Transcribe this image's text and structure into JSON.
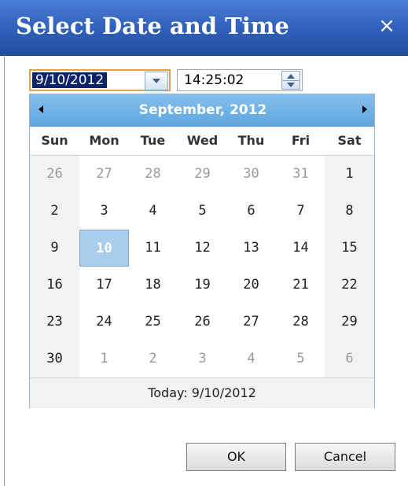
{
  "dialog": {
    "title": "Select Date and Time",
    "close_symbol": "×"
  },
  "date_input": {
    "value": "9/10/2012"
  },
  "time_input": {
    "value": "14:25:02"
  },
  "calendar": {
    "month_label": "September, 2012",
    "weekdays": [
      "Sun",
      "Mon",
      "Tue",
      "Wed",
      "Thu",
      "Fri",
      "Sat"
    ],
    "weeks": [
      [
        {
          "d": "26",
          "other": true
        },
        {
          "d": "27",
          "other": true
        },
        {
          "d": "28",
          "other": true
        },
        {
          "d": "29",
          "other": true
        },
        {
          "d": "30",
          "other": true
        },
        {
          "d": "31",
          "other": true
        },
        {
          "d": "1"
        }
      ],
      [
        {
          "d": "2"
        },
        {
          "d": "3"
        },
        {
          "d": "4"
        },
        {
          "d": "5"
        },
        {
          "d": "6"
        },
        {
          "d": "7"
        },
        {
          "d": "8"
        }
      ],
      [
        {
          "d": "9"
        },
        {
          "d": "10",
          "selected": true
        },
        {
          "d": "11"
        },
        {
          "d": "12"
        },
        {
          "d": "13"
        },
        {
          "d": "14"
        },
        {
          "d": "15"
        }
      ],
      [
        {
          "d": "16"
        },
        {
          "d": "17"
        },
        {
          "d": "18"
        },
        {
          "d": "19"
        },
        {
          "d": "20"
        },
        {
          "d": "21"
        },
        {
          "d": "22"
        }
      ],
      [
        {
          "d": "23"
        },
        {
          "d": "24"
        },
        {
          "d": "25"
        },
        {
          "d": "26"
        },
        {
          "d": "27"
        },
        {
          "d": "28"
        },
        {
          "d": "29"
        }
      ],
      [
        {
          "d": "30"
        },
        {
          "d": "1",
          "other": true
        },
        {
          "d": "2",
          "other": true
        },
        {
          "d": "3",
          "other": true
        },
        {
          "d": "4",
          "other": true
        },
        {
          "d": "5",
          "other": true
        },
        {
          "d": "6",
          "other": true
        }
      ]
    ],
    "footer": "Today: 9/10/2012"
  },
  "buttons": {
    "ok": "OK",
    "cancel": "Cancel"
  },
  "colors": {
    "title_bar": "#2f5fb8",
    "calendar_header": "#5ea6e0",
    "selected_day": "#a9cdec",
    "date_highlight": "#0a246a",
    "focus_border": "#e2a24a"
  }
}
